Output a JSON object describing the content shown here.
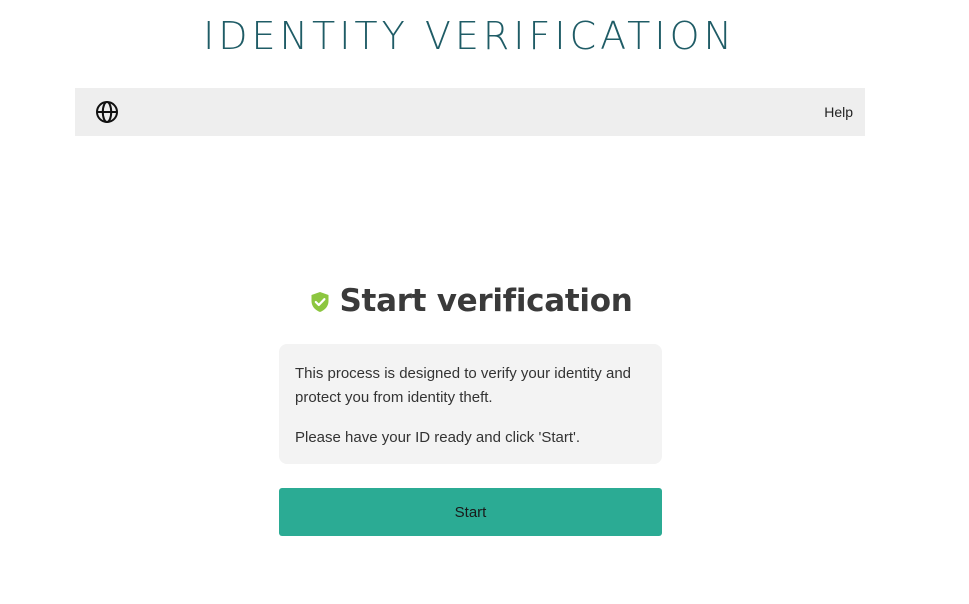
{
  "header": {
    "title": "IDENTITY VERIFICATION"
  },
  "toolbar": {
    "language_icon": "globe-icon",
    "help_label": "Help"
  },
  "main": {
    "status_icon": "shield-check-icon",
    "heading": "Start verification",
    "info_paragraph_1": "This process is designed to verify your identity and protect you from identity theft.",
    "info_paragraph_2": "Please have your ID ready and click 'Start'.",
    "start_label": "Start"
  },
  "colors": {
    "title": "#1f5c66",
    "toolbar_bg": "#eeeeee",
    "shield": "#8cc63f",
    "info_bg": "#f3f3f3",
    "button_bg": "#2bab94"
  }
}
